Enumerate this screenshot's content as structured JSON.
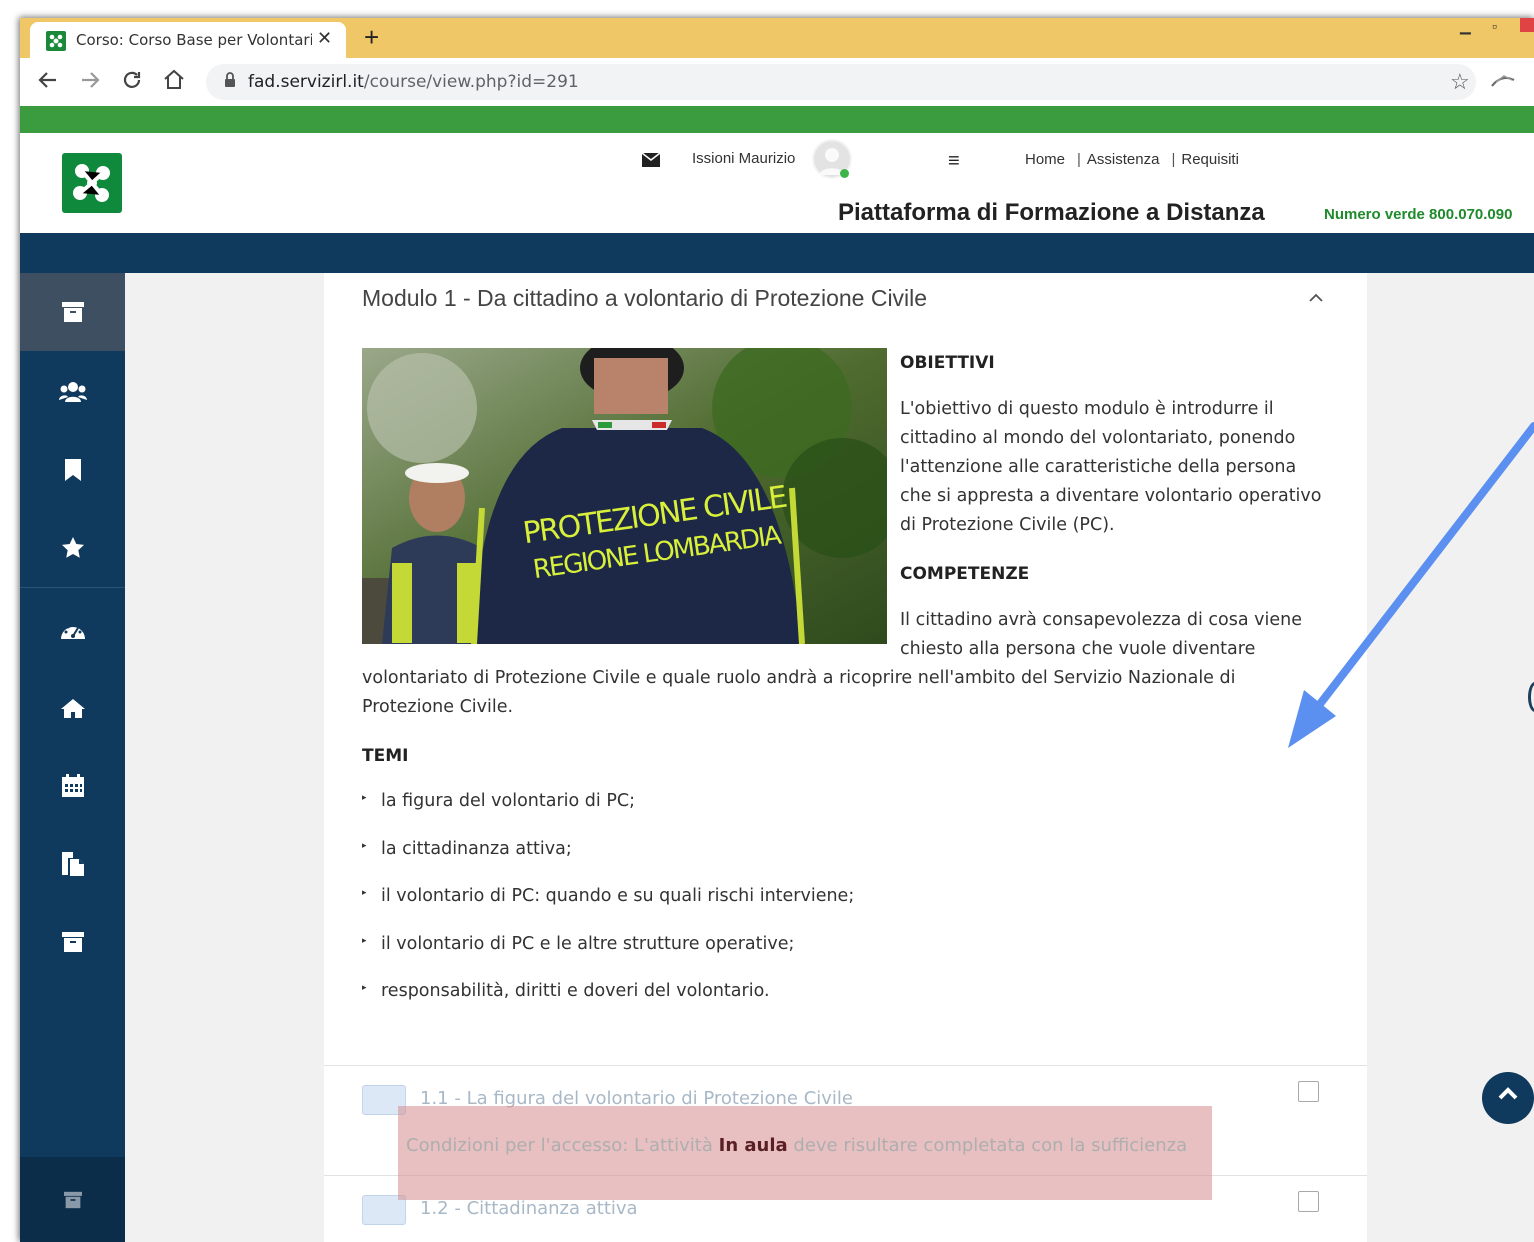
{
  "browser": {
    "tab_title": "Corso: Corso Base per Volontari d",
    "tab_close": "✕",
    "new_tab": "+",
    "url_host": "fad.servizirl.it",
    "url_path": "/course/view.php?id=291"
  },
  "site_header": {
    "user_name": "Issioni Maurizio",
    "nav": {
      "home": "Home",
      "assistenza": "Assistenza",
      "requisiti": "Requisiti",
      "separator": "|"
    },
    "platform_title": "Piattaforma di Formazione a Distanza",
    "phone": "Numero verde 800.070.090"
  },
  "sidebar": {
    "items": [
      {
        "icon": "archive-icon",
        "active": true
      },
      {
        "icon": "users-icon"
      },
      {
        "icon": "bookmark-icon"
      },
      {
        "icon": "star-icon"
      },
      {
        "icon": "dashboard-icon"
      },
      {
        "icon": "home-icon"
      },
      {
        "icon": "calendar-icon"
      },
      {
        "icon": "files-icon"
      },
      {
        "icon": "archive-icon"
      }
    ],
    "footer_icon": "archive-icon"
  },
  "module": {
    "title": "Modulo 1 - Da cittadino a volontario di Protezione Civile",
    "photo_text_line1": "PROTEZIONE CIVILE",
    "photo_text_line2": "REGIONE LOMBARDIA",
    "obiettivi_heading": "OBIETTIVI",
    "obiettivi_text": "L'obiettivo di questo modulo è introdurre il cittadino al mondo del volontariato, ponendo l'attenzione alle caratteristiche della persona che si appresta a diventare volontario operativo di Protezione Civile (PC).",
    "competenze_heading": "COMPETENZE",
    "competenze_text_a": "Il cittadino avrà consapevolezza di cosa viene chiesto alla persona che vuole diventare",
    "competenze_text_b": "volontariato di Protezione Civile e quale ruolo andrà a ricoprire nell'ambito del Servizio Nazionale di Protezione Civile.",
    "temi_heading": "TEMI",
    "temi": [
      "la figura del volontario di PC;",
      "la cittadinanza attiva;",
      "il volontario di PC: quando e su quali rischi interviene;",
      "il volontario di PC e le altre strutture operative;",
      "responsabilità, diritti e doveri del volontario."
    ]
  },
  "activities": [
    {
      "label": "1.1 - La figura del volontario di Protezione Civile"
    },
    {
      "label": "1.2 - Cittadinanza attiva"
    }
  ],
  "restriction": {
    "prefix": "Condizioni per l'accesso: L'attività ",
    "activity": "In aula",
    "suffix": " deve risultare completata con la sufficienza"
  },
  "colors": {
    "green_bar": "#3b9b3f",
    "navy": "#0f3a5d",
    "tab_strip": "#f0c766",
    "annotation_arrow": "#5b8ff0",
    "restriction_highlight": "#d68c90"
  }
}
